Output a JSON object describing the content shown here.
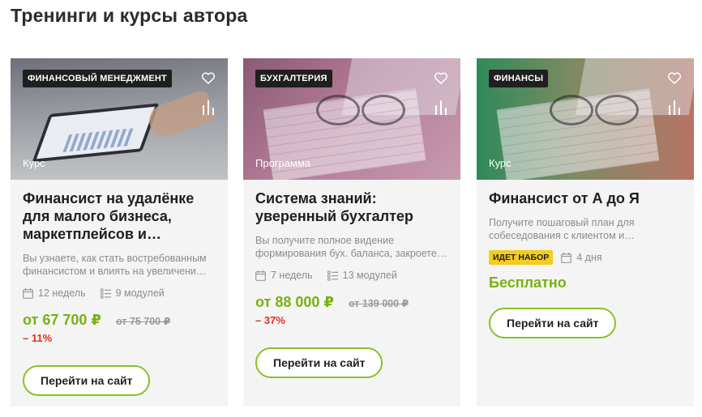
{
  "page": {
    "title": "Тренинги и курсы автора"
  },
  "colors": {
    "accent": "#78b20f",
    "discount": "#e52a23",
    "badge_yellow": "#f3cd1f"
  },
  "icons": {
    "favorite": "heart-icon",
    "compare": "compare-icon",
    "duration": "calendar-icon",
    "modules": "list-icon"
  },
  "cards": [
    {
      "category": "ФИНАНСОВЫЙ МЕНЕДЖМЕНТ",
      "type": "Курс",
      "title": "Финансист на удалёнке для малого бизнеса, маркетплейсов и онлайн…",
      "description": "Вы узнаете, как стать востребованным финансистом и влиять на увеличени…",
      "duration": "12 недель",
      "modules": "9 модулей",
      "price": "от 67 700 ₽",
      "old_price": "от 75 700 ₽",
      "discount": "– 11%",
      "cta": "Перейти на сайт"
    },
    {
      "category": "БУХГАЛТЕРИЯ",
      "type": "Программа",
      "title": "Система знаний: уверенный бухгалтер",
      "description": "Вы получите полное видение формирования бух. баланса, закроете…",
      "duration": "7 недель",
      "modules": "13 модулей",
      "price": "от 88 000 ₽",
      "old_price": "от 139 000 ₽",
      "discount": "– 37%",
      "cta": "Перейти на сайт"
    },
    {
      "category": "ФИНАНСЫ",
      "type": "Курс",
      "title": "Финансист от А до Я",
      "description": "Получите пошаговый план для собеседования с клиентом и…",
      "badge": "ИДЕТ НАБОР",
      "duration": "4 дня",
      "price": "Бесплатно",
      "cta": "Перейти на сайт"
    }
  ]
}
